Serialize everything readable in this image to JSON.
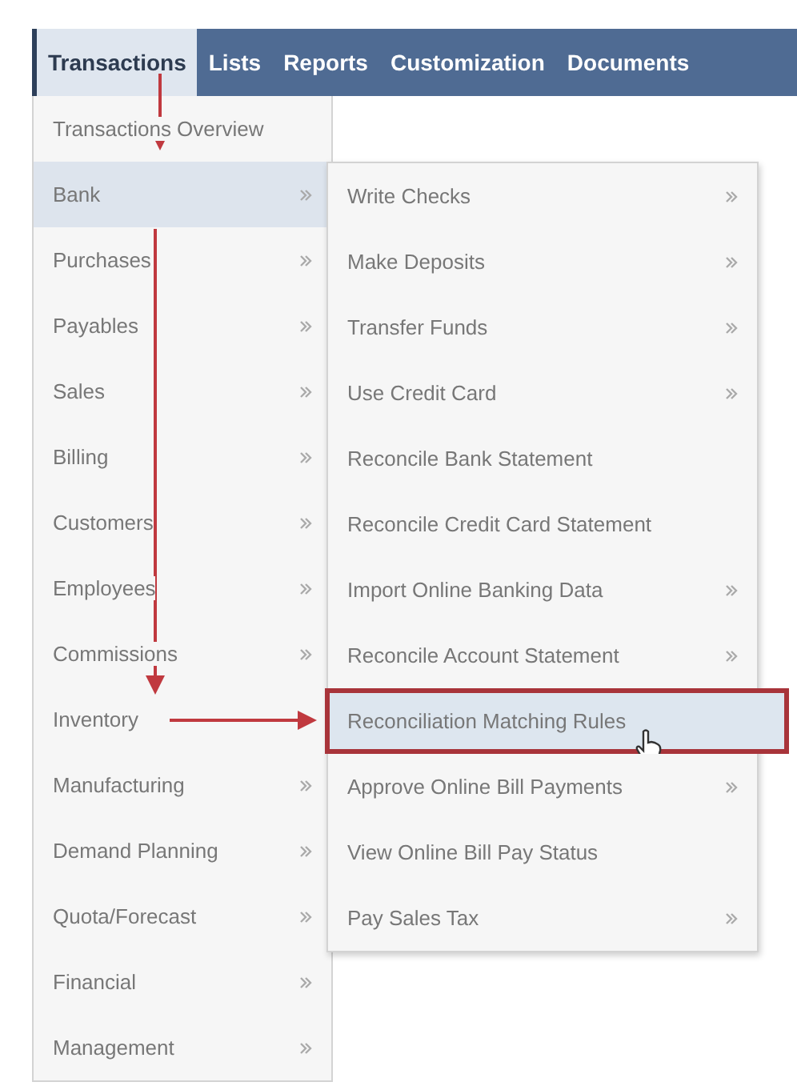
{
  "nav": [
    {
      "label": "Transactions",
      "selected": true
    },
    {
      "label": "Lists",
      "selected": false
    },
    {
      "label": "Reports",
      "selected": false
    },
    {
      "label": "Customization",
      "selected": false
    },
    {
      "label": "Documents",
      "selected": false
    }
  ],
  "menu": [
    {
      "label": "Transactions Overview",
      "has_submenu": false,
      "selected": false
    },
    {
      "label": "Bank",
      "has_submenu": true,
      "selected": true
    },
    {
      "label": "Purchases",
      "has_submenu": true,
      "selected": false
    },
    {
      "label": "Payables",
      "has_submenu": true,
      "selected": false
    },
    {
      "label": "Sales",
      "has_submenu": true,
      "selected": false
    },
    {
      "label": "Billing",
      "has_submenu": true,
      "selected": false
    },
    {
      "label": "Customers",
      "has_submenu": true,
      "selected": false
    },
    {
      "label": "Employees",
      "has_submenu": true,
      "selected": false
    },
    {
      "label": "Commissions",
      "has_submenu": true,
      "selected": false
    },
    {
      "label": "Inventory",
      "has_submenu": false,
      "selected": false
    },
    {
      "label": "Manufacturing",
      "has_submenu": true,
      "selected": false
    },
    {
      "label": "Demand Planning",
      "has_submenu": true,
      "selected": false
    },
    {
      "label": "Quota/Forecast",
      "has_submenu": true,
      "selected": false
    },
    {
      "label": "Financial",
      "has_submenu": true,
      "selected": false
    },
    {
      "label": "Management",
      "has_submenu": true,
      "selected": false
    }
  ],
  "submenu": [
    {
      "label": "Write Checks",
      "has_submenu": true,
      "selected": false
    },
    {
      "label": "Make Deposits",
      "has_submenu": true,
      "selected": false
    },
    {
      "label": "Transfer Funds",
      "has_submenu": true,
      "selected": false
    },
    {
      "label": "Use Credit Card",
      "has_submenu": true,
      "selected": false
    },
    {
      "label": "Reconcile Bank Statement",
      "has_submenu": false,
      "selected": false
    },
    {
      "label": "Reconcile Credit Card Statement",
      "has_submenu": false,
      "selected": false
    },
    {
      "label": "Import Online Banking Data",
      "has_submenu": true,
      "selected": false
    },
    {
      "label": "Reconcile Account Statement",
      "has_submenu": true,
      "selected": false
    },
    {
      "label": "Reconciliation Matching Rules",
      "has_submenu": false,
      "selected": true
    },
    {
      "label": "Approve Online Bill Payments",
      "has_submenu": true,
      "selected": false
    },
    {
      "label": "View Online Bill Pay Status",
      "has_submenu": false,
      "selected": false
    },
    {
      "label": "Pay Sales Tax",
      "has_submenu": true,
      "selected": false
    }
  ]
}
